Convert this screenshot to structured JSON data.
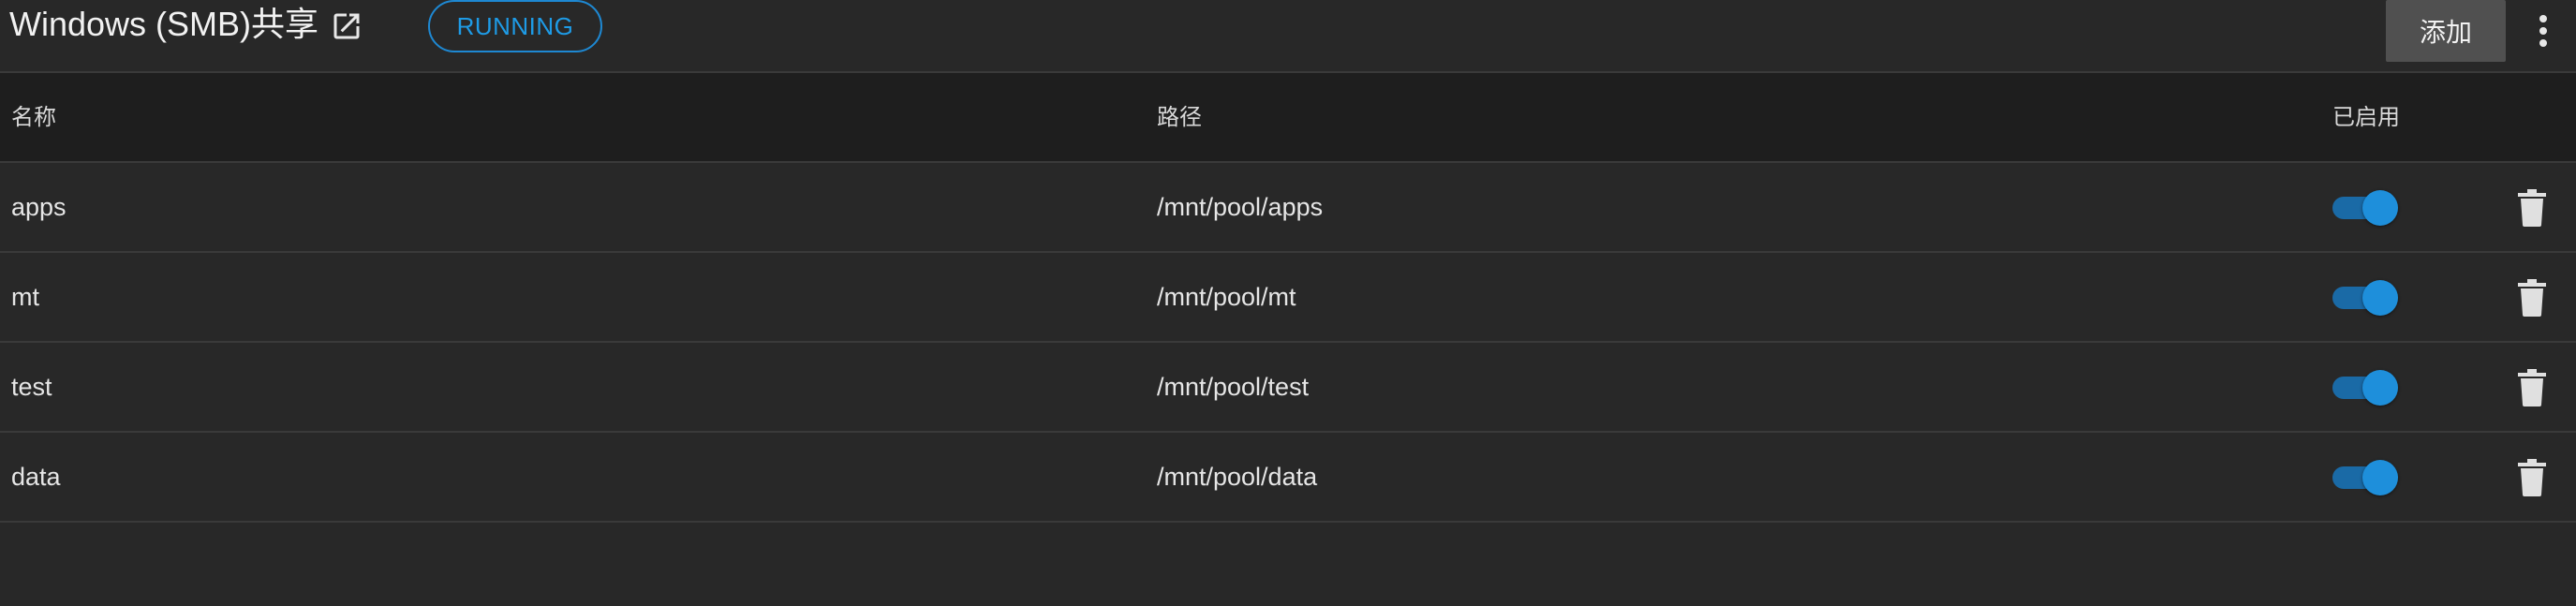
{
  "header": {
    "title": "Windows (SMB)共享",
    "status": "RUNNING",
    "add_label": "添加",
    "icons": {
      "external": "open-in-new-icon",
      "more": "more-vert-icon"
    }
  },
  "table": {
    "columns": {
      "name": "名称",
      "path": "路径",
      "enabled": "已启用"
    },
    "rows": [
      {
        "name": "apps",
        "path": "/mnt/pool/apps",
        "enabled": true
      },
      {
        "name": "mt",
        "path": "/mnt/pool/mt",
        "enabled": true
      },
      {
        "name": "test",
        "path": "/mnt/pool/test",
        "enabled": true
      },
      {
        "name": "data",
        "path": "/mnt/pool/data",
        "enabled": true
      }
    ]
  },
  "colors": {
    "accent": "#1e8fdb",
    "background": "#282828",
    "header_row": "#1e1e1e",
    "button": "#505050"
  }
}
